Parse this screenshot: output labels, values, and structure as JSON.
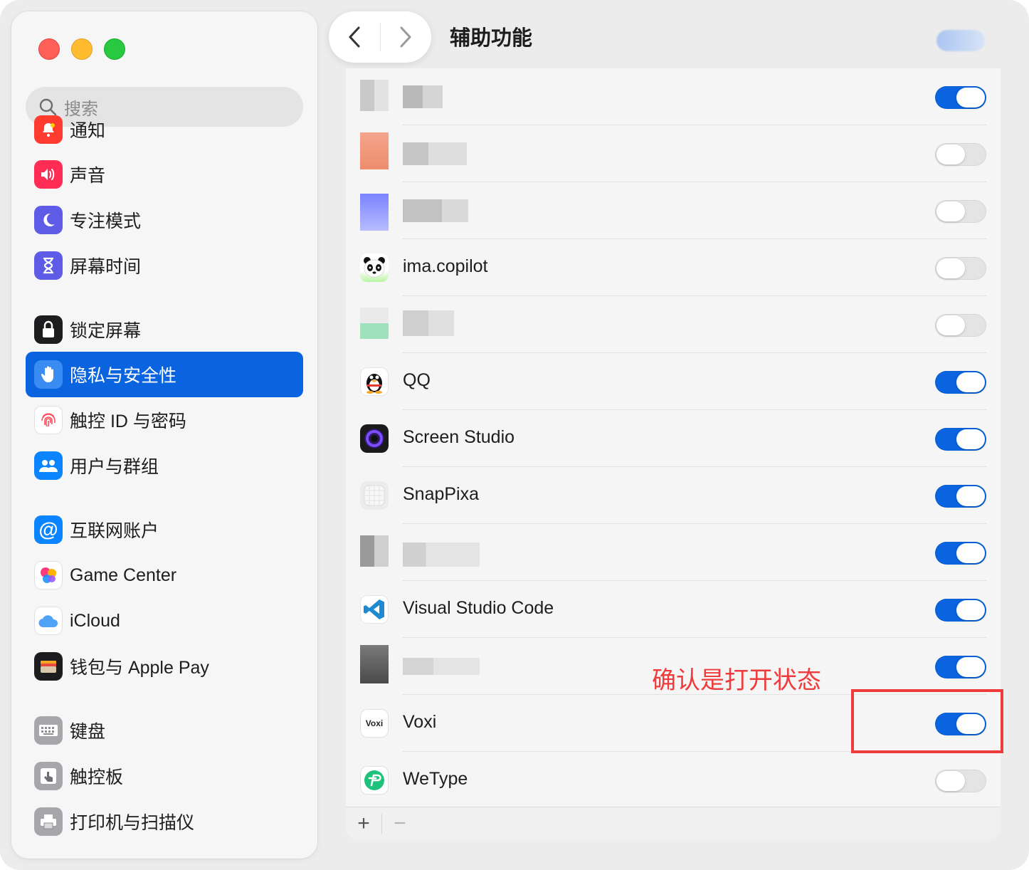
{
  "sidebar": {
    "search_placeholder": "搜索",
    "items": [
      {
        "label": "通知",
        "color": "#ff3b30",
        "icon": "bell-icon"
      },
      {
        "label": "声音",
        "color": "#ff2d55",
        "icon": "speaker-icon"
      },
      {
        "label": "专注模式",
        "color": "#5e5ce6",
        "icon": "moon-icon"
      },
      {
        "label": "屏幕时间",
        "color": "#5e5ce6",
        "icon": "hourglass-icon"
      },
      {
        "label": "锁定屏幕",
        "color": "#1d1d1f",
        "icon": "lock-icon"
      },
      {
        "label": "隐私与安全性",
        "color": "#0a84ff",
        "icon": "hand-icon",
        "active": true
      },
      {
        "label": "触控 ID 与密码",
        "color": "#ffffff",
        "icon": "fingerprint-icon"
      },
      {
        "label": "用户与群组",
        "color": "#0a84ff",
        "icon": "users-icon"
      },
      {
        "label": "互联网账户",
        "color": "#0a84ff",
        "icon": "at-icon"
      },
      {
        "label": "Game Center",
        "color": "#ffffff",
        "icon": "game-center-icon"
      },
      {
        "label": "iCloud",
        "color": "#ffffff",
        "icon": "cloud-icon"
      },
      {
        "label": "钱包与 Apple Pay",
        "color": "#1d1d1f",
        "icon": "wallet-icon"
      },
      {
        "label": "键盘",
        "color": "#8e8e93",
        "icon": "keyboard-icon"
      },
      {
        "label": "触控板",
        "color": "#8e8e93",
        "icon": "trackpad-icon"
      },
      {
        "label": "打印机与扫描仪",
        "color": "#8e8e93",
        "icon": "printer-icon"
      }
    ]
  },
  "main": {
    "title": "辅助功能",
    "apps": [
      {
        "name": "",
        "on": true,
        "blurred": true
      },
      {
        "name": "",
        "on": false,
        "blurred": true
      },
      {
        "name": "",
        "on": false,
        "blurred": true
      },
      {
        "name": "ima.copilot",
        "on": false,
        "icon": "panda-icon"
      },
      {
        "name": "",
        "on": false,
        "blurred": true
      },
      {
        "name": "QQ",
        "on": true,
        "icon": "qq-penguin-icon"
      },
      {
        "name": "Screen Studio",
        "on": true,
        "icon": "screen-studio-icon"
      },
      {
        "name": "SnapPixa",
        "on": true,
        "icon": "snappixa-icon"
      },
      {
        "name": "",
        "on": true,
        "blurred": true
      },
      {
        "name": "Visual Studio Code",
        "on": true,
        "icon": "vscode-icon"
      },
      {
        "name": "",
        "on": true,
        "blurred": true
      },
      {
        "name": "Voxi",
        "on": true,
        "icon": "voxi-icon",
        "icon_text": "Voxi"
      },
      {
        "name": "WeType",
        "on": false,
        "icon": "wetype-icon"
      }
    ],
    "footer": {
      "add": "+",
      "remove": "−"
    }
  },
  "annotation": {
    "text": "确认是打开状态",
    "color": "#ef3b3b"
  },
  "colors": {
    "accent": "#0a64e0",
    "toggle_off": "#e4e4e4"
  }
}
